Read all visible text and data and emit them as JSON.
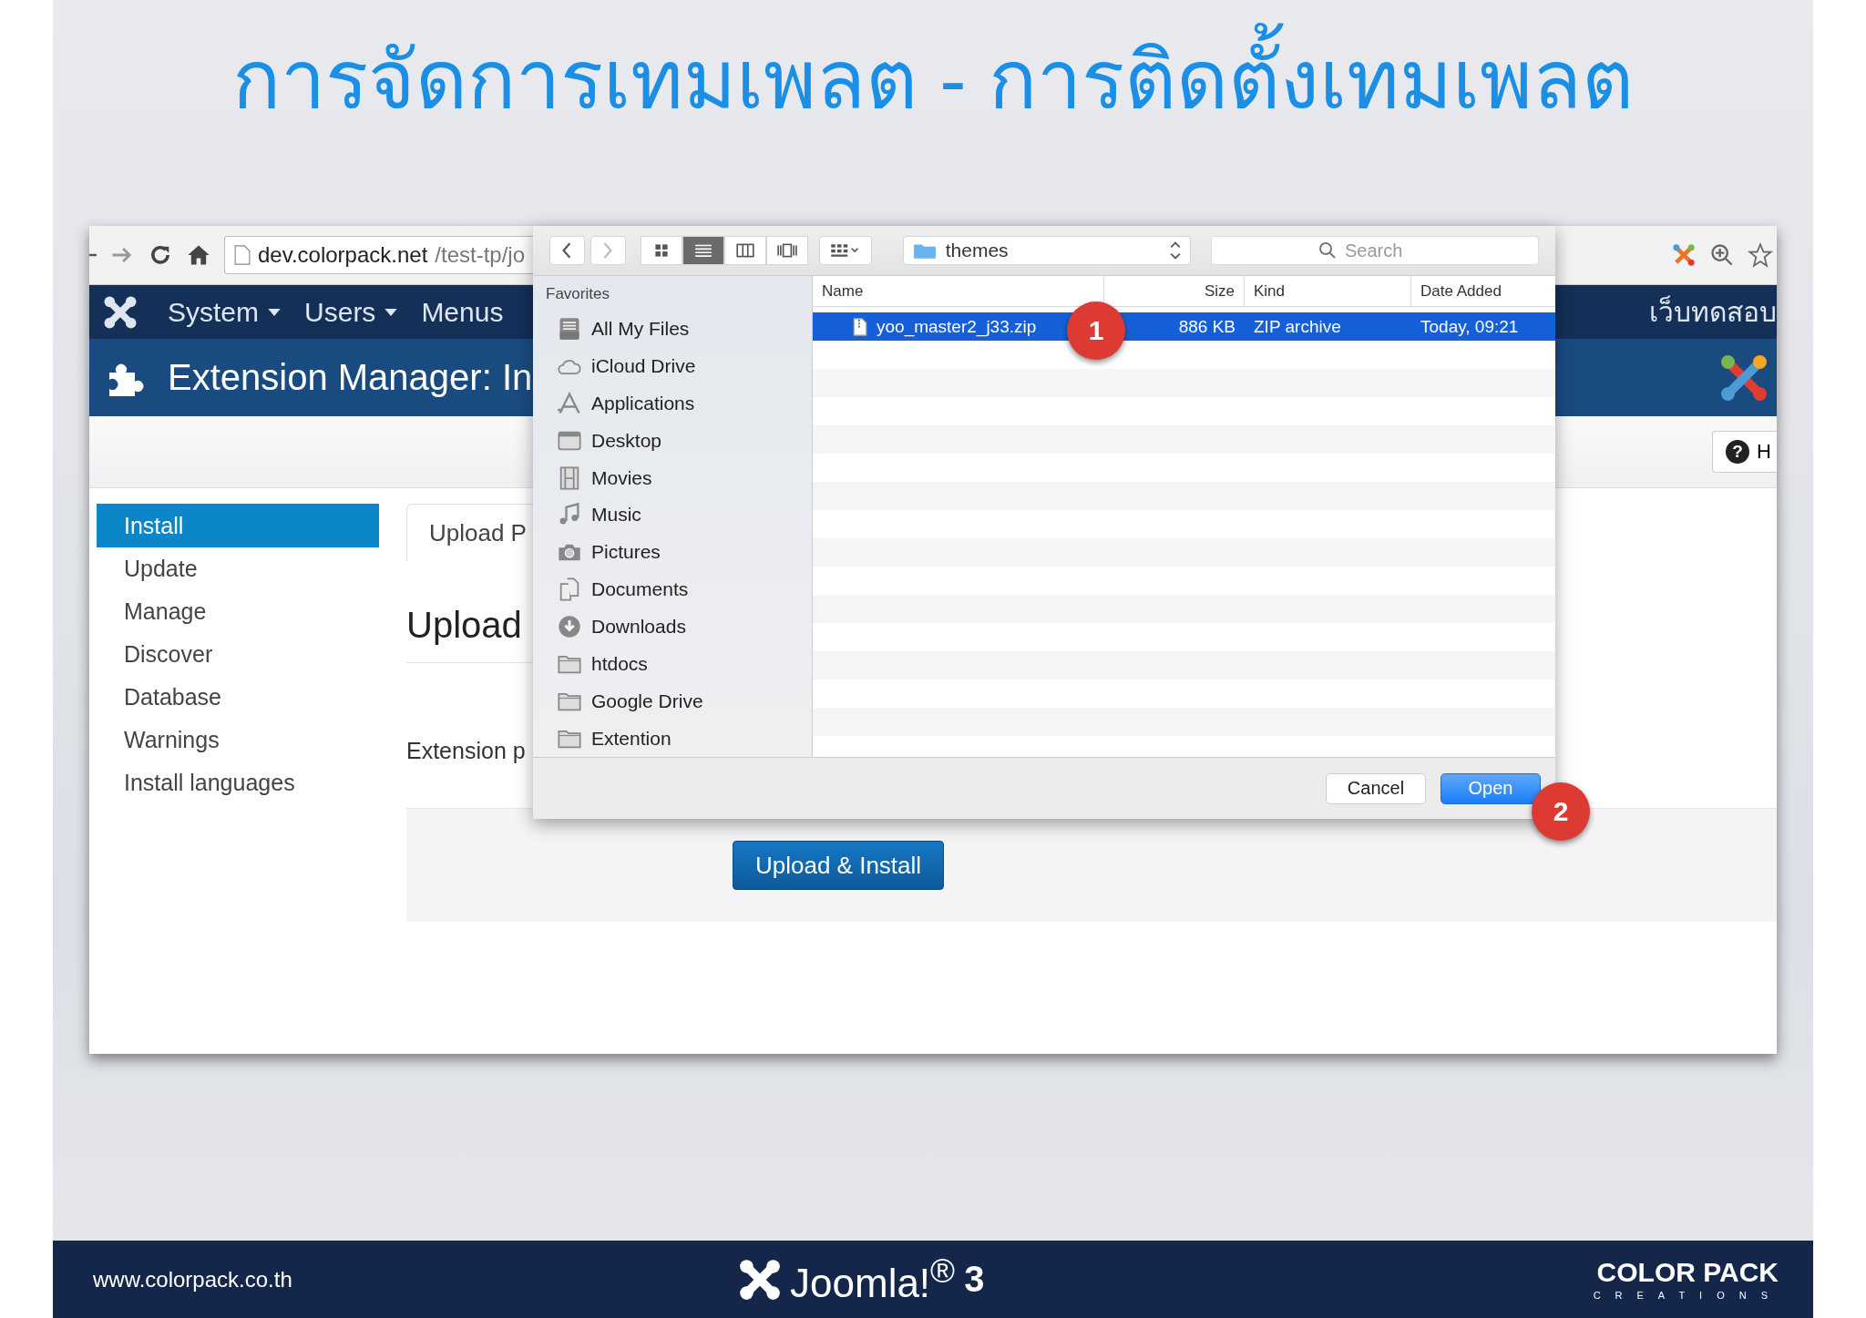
{
  "slide": {
    "title": "การจัดการเทมเพลต - การติดตั้งเทมเพลต"
  },
  "browser": {
    "url_host": "dev.colorpack.net",
    "url_path": "/test-tp/jo",
    "nav": [
      {
        "label": "System",
        "dropdown": true
      },
      {
        "label": "Users",
        "dropdown": true
      },
      {
        "label": "Menus",
        "dropdown": false
      }
    ],
    "site_name": "เว็บทดสอบ",
    "header_title": "Extension Manager: In",
    "help_glyph": "?",
    "help_label": "H",
    "sidebar": [
      {
        "label": "Install",
        "selected": true
      },
      {
        "label": "Update",
        "selected": false
      },
      {
        "label": "Manage",
        "selected": false
      },
      {
        "label": "Discover",
        "selected": false
      },
      {
        "label": "Database",
        "selected": false
      },
      {
        "label": "Warnings",
        "selected": false
      },
      {
        "label": "Install languages",
        "selected": false
      }
    ],
    "tab": "Upload P",
    "heading": "Upload",
    "field_label": "Extension p",
    "upload_button": "Upload & Install"
  },
  "dialog": {
    "view_modes": [
      {
        "kind": "icons",
        "selected": false
      },
      {
        "kind": "list",
        "selected": true
      },
      {
        "kind": "columns",
        "selected": false
      },
      {
        "kind": "coverflow",
        "selected": false
      }
    ],
    "location": "themes",
    "search": {
      "placeholder": "Search"
    },
    "sidebar": {
      "heading": "Favorites",
      "items": [
        {
          "label": "All My Files",
          "kind": "files"
        },
        {
          "label": "iCloud Drive",
          "kind": "cloud"
        },
        {
          "label": "Applications",
          "kind": "apps"
        },
        {
          "label": "Desktop",
          "kind": "desktop"
        },
        {
          "label": "Movies",
          "kind": "movies"
        },
        {
          "label": "Music",
          "kind": "music"
        },
        {
          "label": "Pictures",
          "kind": "pictures"
        },
        {
          "label": "Documents",
          "kind": "documents"
        },
        {
          "label": "Downloads",
          "kind": "downloads"
        },
        {
          "label": "htdocs",
          "kind": "folder"
        },
        {
          "label": "Google Drive",
          "kind": "folder"
        },
        {
          "label": "Extention",
          "kind": "folder"
        }
      ]
    },
    "columns": [
      "Name",
      "Size",
      "Kind",
      "Date Added"
    ],
    "files": [
      {
        "name": "yoo_master2_j33.zip",
        "size": "886 KB",
        "kind": "ZIP archive",
        "date_added": "Today, 09:21",
        "selected": true
      }
    ],
    "buttons": {
      "cancel": "Cancel",
      "open": "Open"
    }
  },
  "callouts": [
    "1",
    "2"
  ],
  "footer": {
    "website": "www.colorpack.co.th",
    "product": "Joomla!$^{®}$",
    "version": "3",
    "brand": "COLOR PACK",
    "brand_sub": "CREATIONS"
  }
}
